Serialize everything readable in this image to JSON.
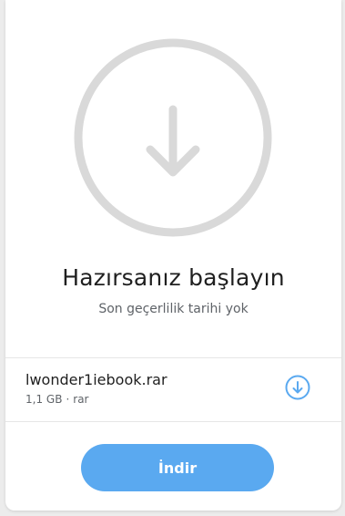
{
  "hero": {
    "icon": "download-arrow-circle-icon",
    "title": "Hazırsanız başlayın",
    "subtitle": "Son geçerlilik tarihi yok"
  },
  "file": {
    "name": "lwonder1iebook.rar",
    "size": "1,1 GB",
    "separator": "·",
    "type": "rar",
    "action_icon": "download-circle-icon"
  },
  "actions": {
    "download_label": "İndir"
  },
  "colors": {
    "accent": "#5aa9f0",
    "icon_grey": "#d9d9d9",
    "text_primary": "#1f1f1f",
    "text_secondary": "#5f6368"
  }
}
